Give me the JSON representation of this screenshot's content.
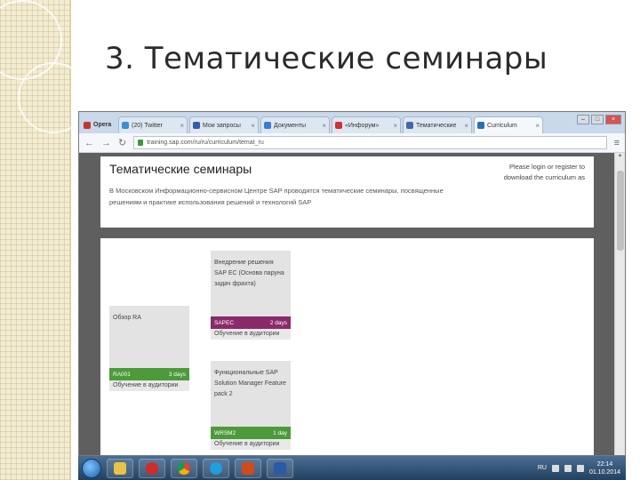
{
  "slide": {
    "title": "3. Тематические семинары"
  },
  "browser": {
    "tabs": [
      {
        "label": "Opera",
        "icon_color": "#c0392b"
      },
      {
        "label": "(20) Twitter",
        "icon_color": "#3a8fd6"
      },
      {
        "label": "Мои запросы",
        "icon_color": "#2f5fa8"
      },
      {
        "label": "Документы",
        "icon_color": "#3c78d8"
      },
      {
        "label": "«Инфорум»",
        "icon_color": "#cc3333"
      },
      {
        "label": "Тематические",
        "icon_color": "#4169a8"
      },
      {
        "label": "Curriculum",
        "icon_color": "#2a6ebb"
      }
    ],
    "url": "training.sap.com/ru/ru/curriculum/temat_ru"
  },
  "page": {
    "heading": "Тематические семинары",
    "description": "В Московском Информационно-сервисном Центре SAP проводятся тематические семинары, посвященные решениям и практике использования решений и технологий SAP",
    "login_hint": "Please login or register to download the curriculum as"
  },
  "cards": [
    {
      "title": "Внедрение решения SAP EC (Основа паруна задач фрахта)",
      "code": "SAPEC",
      "days": "2 days",
      "footer": "Обучение в аудитории",
      "bar_color": "#8b2a6b"
    },
    {
      "title": "Обзор RA",
      "code": "RA001",
      "days": "3 days",
      "footer": "Обучение в аудитории",
      "bar_color": "#4d9a3a"
    },
    {
      "title": "Функциональные SAP Solution Manager Feature pack 2",
      "code": "WRSM2",
      "days": "1 day",
      "footer": "Обучение в аудитории",
      "bar_color": "#4d9a3a"
    }
  ],
  "taskbar": {
    "apps": [
      {
        "name": "explorer",
        "color": "#e8c24a"
      },
      {
        "name": "opera",
        "color": "#d12a2a"
      },
      {
        "name": "chrome",
        "color": "#3f9d4a"
      },
      {
        "name": "skype",
        "color": "#1ea0dd"
      },
      {
        "name": "powerpoint",
        "color": "#d04a20"
      },
      {
        "name": "word",
        "color": "#2b5aa8"
      }
    ],
    "lang": "RU",
    "time": "22:14",
    "date": "01.10.2014"
  }
}
